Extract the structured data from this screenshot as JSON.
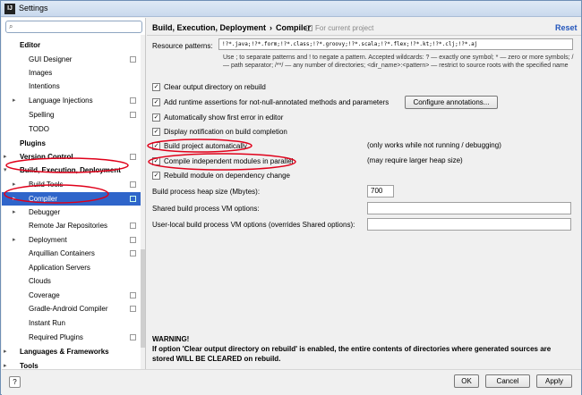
{
  "window": {
    "title": "Settings",
    "icon": "intellij-icon"
  },
  "search": {
    "value": ""
  },
  "tree": [
    {
      "label": "Editor",
      "level": 0,
      "bold": true,
      "arrow": "",
      "copy": false
    },
    {
      "label": "GUI Designer",
      "level": 1,
      "bold": false,
      "arrow": "",
      "copy": true
    },
    {
      "label": "Images",
      "level": 1,
      "bold": false,
      "arrow": "",
      "copy": false
    },
    {
      "label": "Intentions",
      "level": 1,
      "bold": false,
      "arrow": "",
      "copy": false
    },
    {
      "label": "Language Injections",
      "level": 1,
      "bold": false,
      "arrow": ">",
      "copy": true
    },
    {
      "label": "Spelling",
      "level": 1,
      "bold": false,
      "arrow": "",
      "copy": true
    },
    {
      "label": "TODO",
      "level": 1,
      "bold": false,
      "arrow": "",
      "copy": false
    },
    {
      "label": "Plugins",
      "level": 0,
      "bold": true,
      "arrow": "",
      "copy": false
    },
    {
      "label": "Version Control",
      "level": 0,
      "bold": true,
      "arrow": ">",
      "copy": true
    },
    {
      "label": "Build, Execution, Deployment",
      "level": 0,
      "bold": true,
      "arrow": "v",
      "copy": false
    },
    {
      "label": "Build Tools",
      "level": 1,
      "bold": false,
      "arrow": ">",
      "copy": true
    },
    {
      "label": "Compiler",
      "level": 1,
      "bold": false,
      "arrow": ">",
      "copy": true,
      "selected": true
    },
    {
      "label": "Debugger",
      "level": 1,
      "bold": false,
      "arrow": ">",
      "copy": false
    },
    {
      "label": "Remote Jar Repositories",
      "level": 1,
      "bold": false,
      "arrow": "",
      "copy": true
    },
    {
      "label": "Deployment",
      "level": 1,
      "bold": false,
      "arrow": ">",
      "copy": true
    },
    {
      "label": "Arquillian Containers",
      "level": 1,
      "bold": false,
      "arrow": "",
      "copy": true
    },
    {
      "label": "Application Servers",
      "level": 1,
      "bold": false,
      "arrow": "",
      "copy": false
    },
    {
      "label": "Clouds",
      "level": 1,
      "bold": false,
      "arrow": "",
      "copy": false
    },
    {
      "label": "Coverage",
      "level": 1,
      "bold": false,
      "arrow": "",
      "copy": true
    },
    {
      "label": "Gradle-Android Compiler",
      "level": 1,
      "bold": false,
      "arrow": "",
      "copy": true
    },
    {
      "label": "Instant Run",
      "level": 1,
      "bold": false,
      "arrow": "",
      "copy": false
    },
    {
      "label": "Required Plugins",
      "level": 1,
      "bold": false,
      "arrow": "",
      "copy": true
    },
    {
      "label": "Languages & Frameworks",
      "level": 0,
      "bold": true,
      "arrow": ">",
      "copy": false
    },
    {
      "label": "Tools",
      "level": 0,
      "bold": true,
      "arrow": ">",
      "copy": false
    }
  ],
  "header": {
    "crumb1": "Build, Execution, Deployment",
    "sep": "›",
    "crumb2": "Compiler",
    "for_project": "For current project",
    "reset": "Reset"
  },
  "resource": {
    "label": "Resource patterns:",
    "value": "!?*.java;!?*.form;!?*.class;!?*.groovy;!?*.scala;!?*.flex;!?*.kt;!?*.clj;!?*.aj",
    "hint": "Use ; to separate patterns and ! to negate a pattern. Accepted wildcards: ? — exactly one symbol; * — zero or more symbols; / — path separator; /**/ — any number of directories; <dir_name>:<pattern> — restrict to source roots with the specified name"
  },
  "options": [
    {
      "label": "Clear output directory on rebuild",
      "checked": true
    },
    {
      "label": "Add runtime assertions for not-null-annotated methods and parameters",
      "checked": true
    },
    {
      "label": "Automatically show first error in editor",
      "checked": true
    },
    {
      "label": "Display notification on build completion",
      "checked": true
    },
    {
      "label": "Build project automatically",
      "checked": true,
      "note": "(only works while not running / debugging)"
    },
    {
      "label": "Compile independent modules in parallel",
      "checked": true,
      "note": "(may require larger heap size)"
    },
    {
      "label": "Rebuild module on dependency change",
      "checked": true
    }
  ],
  "configure_button": "Configure annotations...",
  "fields": {
    "heap_label": "Build process heap size (Mbytes):",
    "heap_value": "700",
    "shared_label": "Shared build process VM options:",
    "shared_value": "",
    "user_label": "User-local build process VM options (overrides Shared options):",
    "user_value": ""
  },
  "warning": {
    "title": "WARNING!",
    "text": "If option 'Clear output directory on rebuild' is enabled, the entire contents of directories where generated sources are stored WILL BE CLEARED on rebuild."
  },
  "buttons": {
    "help": "?",
    "ok": "OK",
    "cancel": "Cancel",
    "apply": "Apply"
  },
  "colors": {
    "selection": "#2f65ca",
    "annotation": "#e0001a",
    "link": "#2255bb"
  }
}
